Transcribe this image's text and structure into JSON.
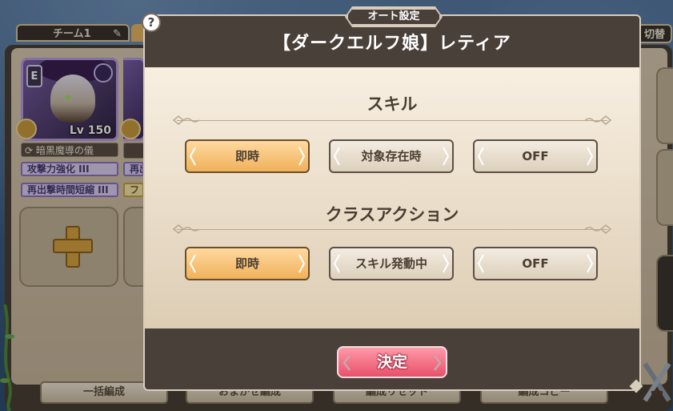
{
  "background": {
    "team_tab_label": "チーム1",
    "switch_tab_label": "切替",
    "character": {
      "rank": "E",
      "level_label": "Lv 150",
      "skill_name": "暗黒魔導の儀"
    },
    "passives": [
      "攻撃力強化 III",
      "再出撃時間短縮 III",
      "再出",
      "フ"
    ],
    "bottom_buttons": [
      "一括編成",
      "おまかせ編成",
      "編成リセット",
      "編成コピー"
    ]
  },
  "modal": {
    "header_tab": "オート設定",
    "help_icon": "?",
    "title": "【ダークエルフ娘】レティア",
    "sections": [
      {
        "title": "スキル",
        "options": [
          {
            "label": "即時",
            "selected": true
          },
          {
            "label": "対象存在時",
            "selected": false
          },
          {
            "label": "OFF",
            "selected": false
          }
        ]
      },
      {
        "title": "クラスアクション",
        "options": [
          {
            "label": "即時",
            "selected": true
          },
          {
            "label": "スキル発動中",
            "selected": false
          },
          {
            "label": "OFF",
            "selected": false
          }
        ]
      }
    ],
    "confirm_label": "決定"
  },
  "colors": {
    "modal_dark": "#4a403a",
    "selected_option": "#f0b15a",
    "confirm_button": "#e8506a"
  },
  "icons": [
    "help-icon",
    "pencil-icon",
    "plus-icon",
    "chevron-left-icon",
    "chevron-right-icon",
    "swords-icon"
  ]
}
